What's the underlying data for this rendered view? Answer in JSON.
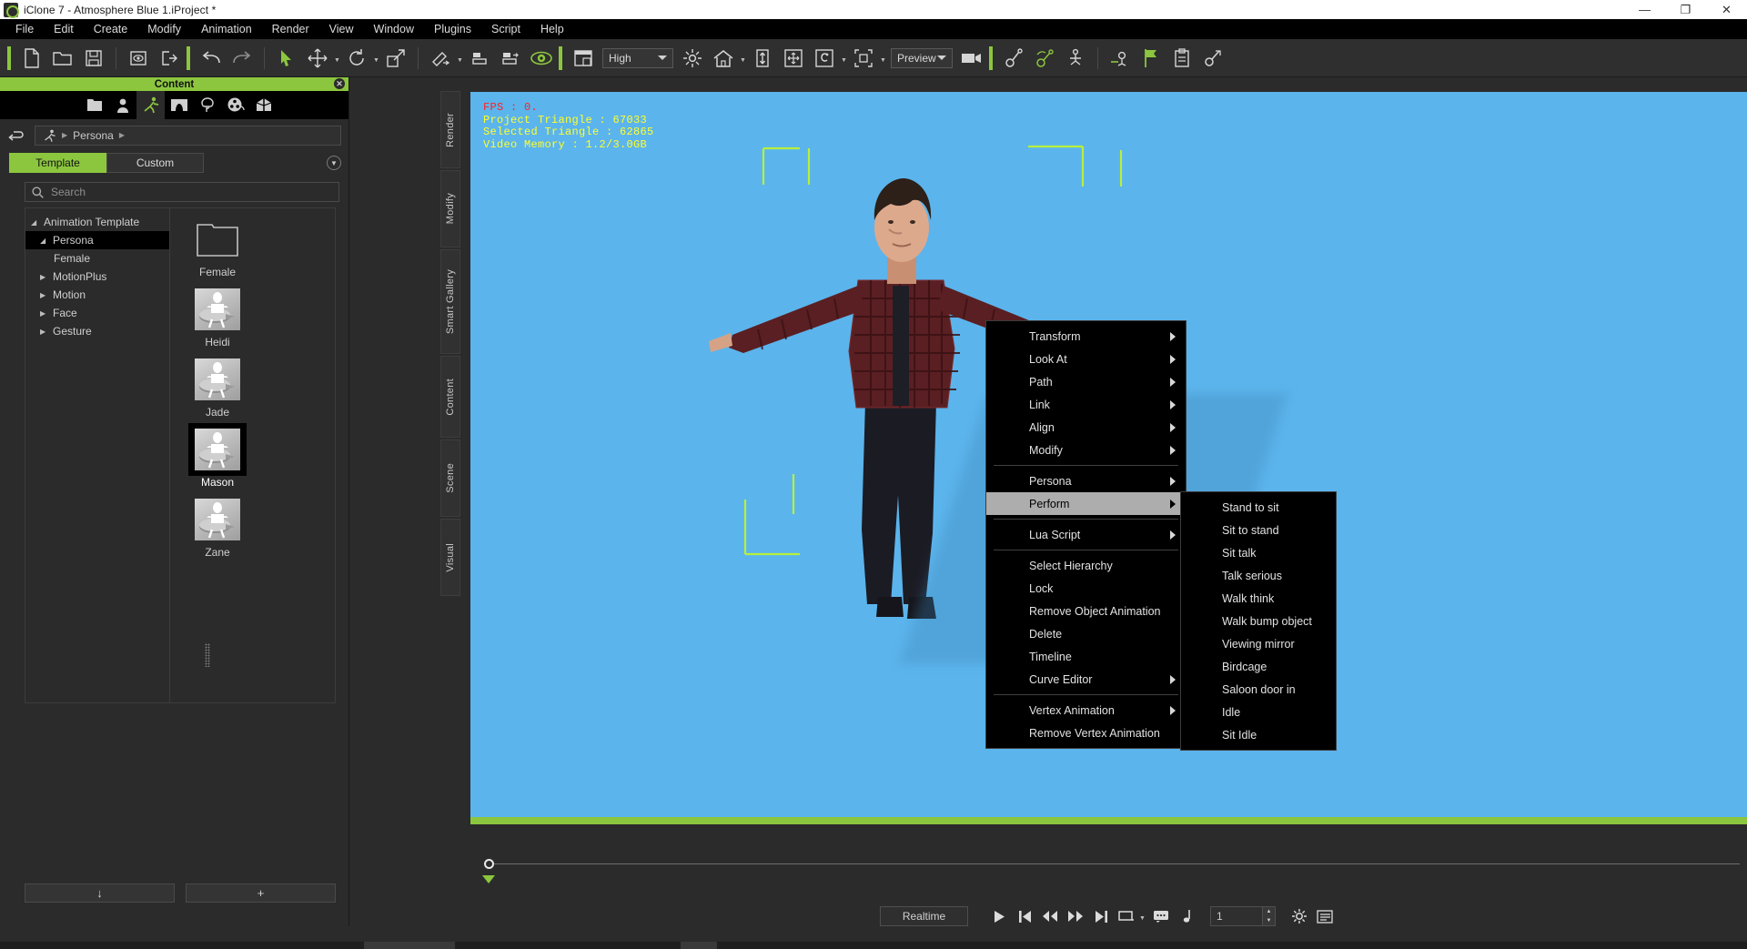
{
  "window": {
    "title": "iClone 7 - Atmosphere Blue 1.iProject *",
    "app_icon": "iclone-icon",
    "buttons": {
      "minimize": "—",
      "maximize": "❐",
      "close": "✕"
    }
  },
  "menubar": {
    "items": [
      {
        "label": "File"
      },
      {
        "label": "Edit"
      },
      {
        "label": "Create"
      },
      {
        "label": "Modify"
      },
      {
        "label": "Animation"
      },
      {
        "label": "Render"
      },
      {
        "label": "View"
      },
      {
        "label": "Window"
      },
      {
        "label": "Plugins"
      },
      {
        "label": "Script"
      },
      {
        "label": "Help"
      }
    ]
  },
  "toolbar": {
    "quality_value": "High",
    "preview_value": "Preview",
    "icons": [
      "new-project-icon",
      "open-project-icon",
      "save-project-icon",
      "load-scene-icon",
      "export-icon",
      "undo-icon",
      "redo-icon",
      "select-tool-icon",
      "move-tool-icon",
      "rotate-tool-icon",
      "scale-tool-icon",
      "material-tool-icon",
      "align-bottom-icon",
      "align-distribute-icon",
      "preview-eye-icon",
      "layout-icon",
      "light-icon",
      "home-icon",
      "vertical-fit-icon",
      "move-all-icon",
      "color-picker-icon",
      "bounding-box-icon",
      "camera-icon",
      "spring-icon",
      "physics-icon",
      "kinematics-icon",
      "motion-layer-icon",
      "flag-icon",
      "clipboard-icon",
      "link-tool-icon"
    ]
  },
  "content_panel": {
    "header": "Content",
    "close_icon": "close-icon",
    "tabs": [
      {
        "name": "folder-tab",
        "icon": "folder-icon"
      },
      {
        "name": "actor-tab",
        "icon": "person-icon"
      },
      {
        "name": "animation-tab",
        "icon": "running-man-icon",
        "active": true
      },
      {
        "name": "stage-tab",
        "icon": "stage-icon"
      },
      {
        "name": "prop-tab",
        "icon": "tree-icon"
      },
      {
        "name": "media-tab",
        "icon": "film-reel-icon"
      },
      {
        "name": "package-tab",
        "icon": "package-icon"
      }
    ],
    "breadcrumb": {
      "back_icon": "back-arrow-icon",
      "root_icon": "running-man-icon",
      "path": "Persona"
    },
    "seg_tabs": [
      {
        "label": "Template",
        "active": true
      },
      {
        "label": "Custom",
        "active": false
      }
    ],
    "expand_icon": "chevron-down-icon",
    "search": {
      "placeholder": "Search",
      "value": "",
      "icon": "search-icon"
    },
    "tree": [
      {
        "label": "Animation Template",
        "level": 1,
        "state": "open",
        "selected": false
      },
      {
        "label": "Persona",
        "level": 2,
        "state": "open",
        "selected": true
      },
      {
        "label": "Female",
        "level": 3,
        "state": "none",
        "selected": false
      },
      {
        "label": "MotionPlus",
        "level": 2,
        "state": "closed",
        "selected": false
      },
      {
        "label": "Motion",
        "level": 2,
        "state": "closed",
        "selected": false
      },
      {
        "label": "Face",
        "level": 2,
        "state": "closed",
        "selected": false
      },
      {
        "label": "Gesture",
        "level": 2,
        "state": "closed",
        "selected": false
      }
    ],
    "thumbnails": [
      {
        "label": "Female",
        "kind": "folder",
        "selected": false
      },
      {
        "label": "Heidi",
        "kind": "persona",
        "selected": false
      },
      {
        "label": "Jade",
        "kind": "persona",
        "selected": false
      },
      {
        "label": "Mason",
        "kind": "persona",
        "selected": true
      },
      {
        "label": "Zane",
        "kind": "persona",
        "selected": false
      }
    ],
    "footer": [
      {
        "name": "apply-button",
        "glyph": "↓"
      },
      {
        "name": "add-button",
        "glyph": "+"
      }
    ]
  },
  "dock_tabs": [
    {
      "label": "Render"
    },
    {
      "label": "Modify"
    },
    {
      "label": "Smart Gallery"
    },
    {
      "label": "Content"
    },
    {
      "label": "Scene"
    },
    {
      "label": "Visual"
    }
  ],
  "viewport": {
    "background_color": "#5bb4ec",
    "overlay": {
      "fps": "FPS : 0.",
      "project_triangle": "Project Triangle : 67033",
      "selected_triangle": "Selected Triangle : 62865",
      "video_memory": "Video Memory : 1.2/3.0GB"
    },
    "gizmo_color": "#b9ef3c"
  },
  "context_menu": {
    "items": [
      {
        "label": "Transform",
        "submenu": true
      },
      {
        "label": "Look At",
        "submenu": true
      },
      {
        "label": "Path",
        "submenu": true
      },
      {
        "label": "Link",
        "submenu": true
      },
      {
        "label": "Align",
        "submenu": true
      },
      {
        "label": "Modify",
        "submenu": true
      },
      {
        "separator": true
      },
      {
        "label": "Persona",
        "submenu": true
      },
      {
        "label": "Perform",
        "submenu": true,
        "highlight": true
      },
      {
        "separator": true
      },
      {
        "label": "Lua Script",
        "submenu": true
      },
      {
        "separator": true
      },
      {
        "label": "Select Hierarchy",
        "submenu": false
      },
      {
        "label": "Lock",
        "submenu": false
      },
      {
        "label": "Remove Object Animation",
        "submenu": false
      },
      {
        "label": "Delete",
        "submenu": false
      },
      {
        "label": "Timeline",
        "submenu": false
      },
      {
        "label": "Curve Editor",
        "submenu": true
      },
      {
        "separator": true
      },
      {
        "label": "Vertex Animation",
        "submenu": true
      },
      {
        "label": "Remove Vertex Animation",
        "submenu": false
      }
    ]
  },
  "perform_submenu": {
    "items": [
      {
        "label": "Stand to sit"
      },
      {
        "label": "Sit to stand"
      },
      {
        "label": "Sit talk"
      },
      {
        "label": "Talk serious"
      },
      {
        "label": "Walk think"
      },
      {
        "label": "Walk bump object"
      },
      {
        "label": "Viewing mirror"
      },
      {
        "label": "Birdcage"
      },
      {
        "label": "Saloon door in"
      },
      {
        "label": "Idle"
      },
      {
        "label": "Sit Idle"
      }
    ]
  },
  "transport": {
    "mode_label": "Realtime",
    "frame_value": "1",
    "buttons": [
      {
        "name": "play-button",
        "icon": "play-icon"
      },
      {
        "name": "go-to-start-button",
        "icon": "skip-start-icon"
      },
      {
        "name": "step-back-button",
        "icon": "rewind-icon"
      },
      {
        "name": "step-forward-button",
        "icon": "fast-forward-icon"
      },
      {
        "name": "go-to-end-button",
        "icon": "skip-end-icon"
      },
      {
        "name": "range-button",
        "icon": "range-icon"
      },
      {
        "name": "comment-button",
        "icon": "speech-bubble-icon"
      },
      {
        "name": "audio-button",
        "icon": "music-note-icon"
      }
    ],
    "right_buttons": [
      {
        "name": "settings-button",
        "icon": "gear-icon"
      },
      {
        "name": "timeline-button",
        "icon": "timeline-icon"
      }
    ]
  }
}
